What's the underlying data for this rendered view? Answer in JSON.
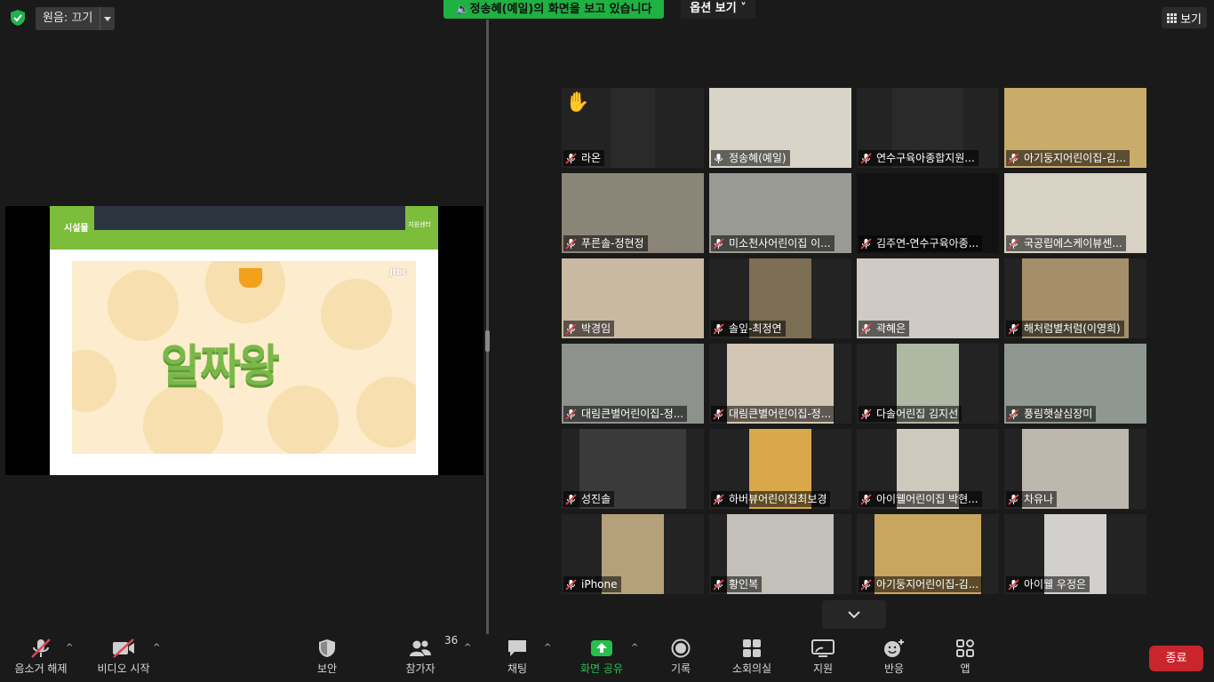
{
  "top_bar": {
    "audio_label": "원음: 끄기",
    "viewing_banner": "정송혜(예일)의 화면을 보고 있습니다",
    "options_label": "옵션 보기",
    "view_label": "보기"
  },
  "shared_slide": {
    "header_label": "시설물",
    "header_right": "지원센터",
    "title": "알짜왕",
    "logo": "Jtbc"
  },
  "participants": [
    {
      "name": "라온",
      "muted": true,
      "hand_raised": true,
      "bg": "#2a2a2a"
    },
    {
      "name": "정송혜(예일)",
      "muted": false,
      "active_speaker": true,
      "bg": "#d9d4c8"
    },
    {
      "name": "연수구육아종합지원...",
      "muted": true,
      "bg": "#2a2a2a"
    },
    {
      "name": "아기둥지어린이집-김...",
      "muted": true,
      "bg": "#c9ab6a"
    },
    {
      "name": "푸른솔-정현정",
      "muted": true,
      "bg": "#8a8577"
    },
    {
      "name": "미소천사어린이집 이...",
      "muted": true,
      "bg": "#9a9a94"
    },
    {
      "name": "김주연-연수구육아종...",
      "muted": true,
      "bg": "#121212"
    },
    {
      "name": "국공립에스케이뷰센...",
      "muted": true,
      "bg": "#d8d2c5"
    },
    {
      "name": "박경임",
      "muted": true,
      "bg": "#c9b9a2"
    },
    {
      "name": "솔잎-최정연",
      "muted": true,
      "bg": "#7b6e55"
    },
    {
      "name": "곽혜은",
      "muted": true,
      "bg": "#cfcac3"
    },
    {
      "name": "해처럼별처럼(이영희)",
      "muted": true,
      "bg": "#a58f6a"
    },
    {
      "name": "대림큰별어린이집-정...",
      "muted": true,
      "bg": "#8e928c"
    },
    {
      "name": "대림큰별어린이집-정...",
      "muted": true,
      "bg": "#d4c6b4"
    },
    {
      "name": "다솔어린집 김지선",
      "muted": true,
      "bg": "#aeb8a3"
    },
    {
      "name": "풍림햇살심장미",
      "muted": true,
      "bg": "#8f9791"
    },
    {
      "name": "성진솔",
      "muted": true,
      "bg": "#3a3a3a"
    },
    {
      "name": "하버뷰어린이집최보경",
      "muted": true,
      "bg": "#d8a84b"
    },
    {
      "name": "아이웰어린이집 박현...",
      "muted": true,
      "bg": "#cfc8bd"
    },
    {
      "name": "차유나",
      "muted": true,
      "bg": "#bdb7ad"
    },
    {
      "name": "iPhone",
      "muted": true,
      "bg": "#b4a07a"
    },
    {
      "name": "황인복",
      "muted": true,
      "bg": "#c3c0ba"
    },
    {
      "name": "아기둥지어린이집-김...",
      "muted": true,
      "bg": "#c9a660"
    },
    {
      "name": "아이웰 우정은",
      "muted": true,
      "bg": "#d2d0cc"
    }
  ],
  "toolbar": {
    "unmute_label": "음소거 해제",
    "video_label": "비디오 시작",
    "security_label": "보안",
    "participants_label": "참가자",
    "participants_count": "36",
    "chat_label": "채팅",
    "share_label": "화면 공유",
    "record_label": "기록",
    "breakout_label": "소회의실",
    "support_label": "지원",
    "reactions_label": "반응",
    "apps_label": "앱",
    "end_label": "종료"
  },
  "colors": {
    "accent_green": "#1fb141",
    "active_border": "#d4f04a",
    "end_red": "#c9252d",
    "mute_red": "#e0454a"
  }
}
